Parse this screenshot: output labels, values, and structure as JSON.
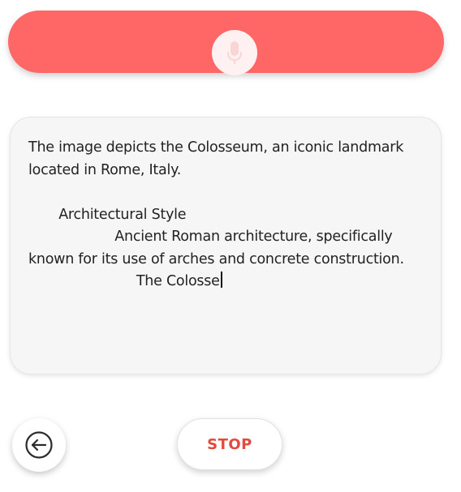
{
  "mic_bar": {
    "icon": "microphone-icon",
    "color": "#ff6666"
  },
  "transcript": {
    "text": "The image depicts the Colosseum, an iconic landmark located in Rome, Italy.\n\n       Architectural Style\n                    Ancient Roman architecture, specifically known for its use of arches and concrete construction.\n                         The Colosse"
  },
  "controls": {
    "back_icon": "arrow-left-circle-icon",
    "stop_label": "STOP",
    "stop_color": "#e24a3b"
  }
}
